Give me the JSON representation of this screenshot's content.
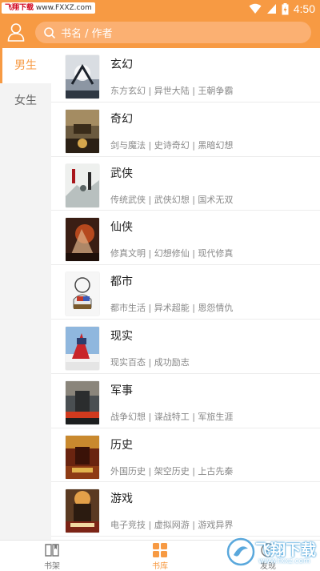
{
  "status_bar": {
    "watermark_brand": "飞翔下载",
    "watermark_url": "www.FXXZ.com",
    "time": "4:50",
    "icons": [
      "wifi-icon",
      "cellular-signal-icon",
      "battery-icon"
    ]
  },
  "header": {
    "avatar_icon": "user-icon",
    "search_placeholder": "书名 / 作者",
    "accent_color": "#f79a43"
  },
  "sidebar": {
    "items": [
      {
        "label": "男生",
        "active": true
      },
      {
        "label": "女生",
        "active": false
      }
    ]
  },
  "genres": [
    {
      "title": "玄幻",
      "tags": "东方玄幻 | 异世大陆 | 王朝争霸"
    },
    {
      "title": "奇幻",
      "tags": "剑与魔法 | 史诗奇幻 | 黑暗幻想"
    },
    {
      "title": "武侠",
      "tags": "传统武侠 | 武侠幻想 | 国术无双"
    },
    {
      "title": "仙侠",
      "tags": "修真文明 | 幻想修仙 | 现代修真"
    },
    {
      "title": "都市",
      "tags": "都市生活 | 异术超能 | 恩怨情仇"
    },
    {
      "title": "现实",
      "tags": "现实百态 | 成功励志"
    },
    {
      "title": "军事",
      "tags": "战争幻想 | 谍战特工 | 军旅生涯"
    },
    {
      "title": "历史",
      "tags": "外国历史 | 架空历史 | 上古先秦"
    },
    {
      "title": "游戏",
      "tags": "电子竞技 | 虚拟网游 | 游戏异界"
    }
  ],
  "bottom_nav": {
    "items": [
      {
        "label": "书架",
        "icon": "book-icon",
        "active": false
      },
      {
        "label": "书库",
        "icon": "grid-icon",
        "active": true
      },
      {
        "label": "发现",
        "icon": "compass-icon",
        "active": false
      }
    ]
  },
  "watermark_bottom": {
    "brand": "飞翔下载",
    "url": "www.fxxz.com"
  }
}
